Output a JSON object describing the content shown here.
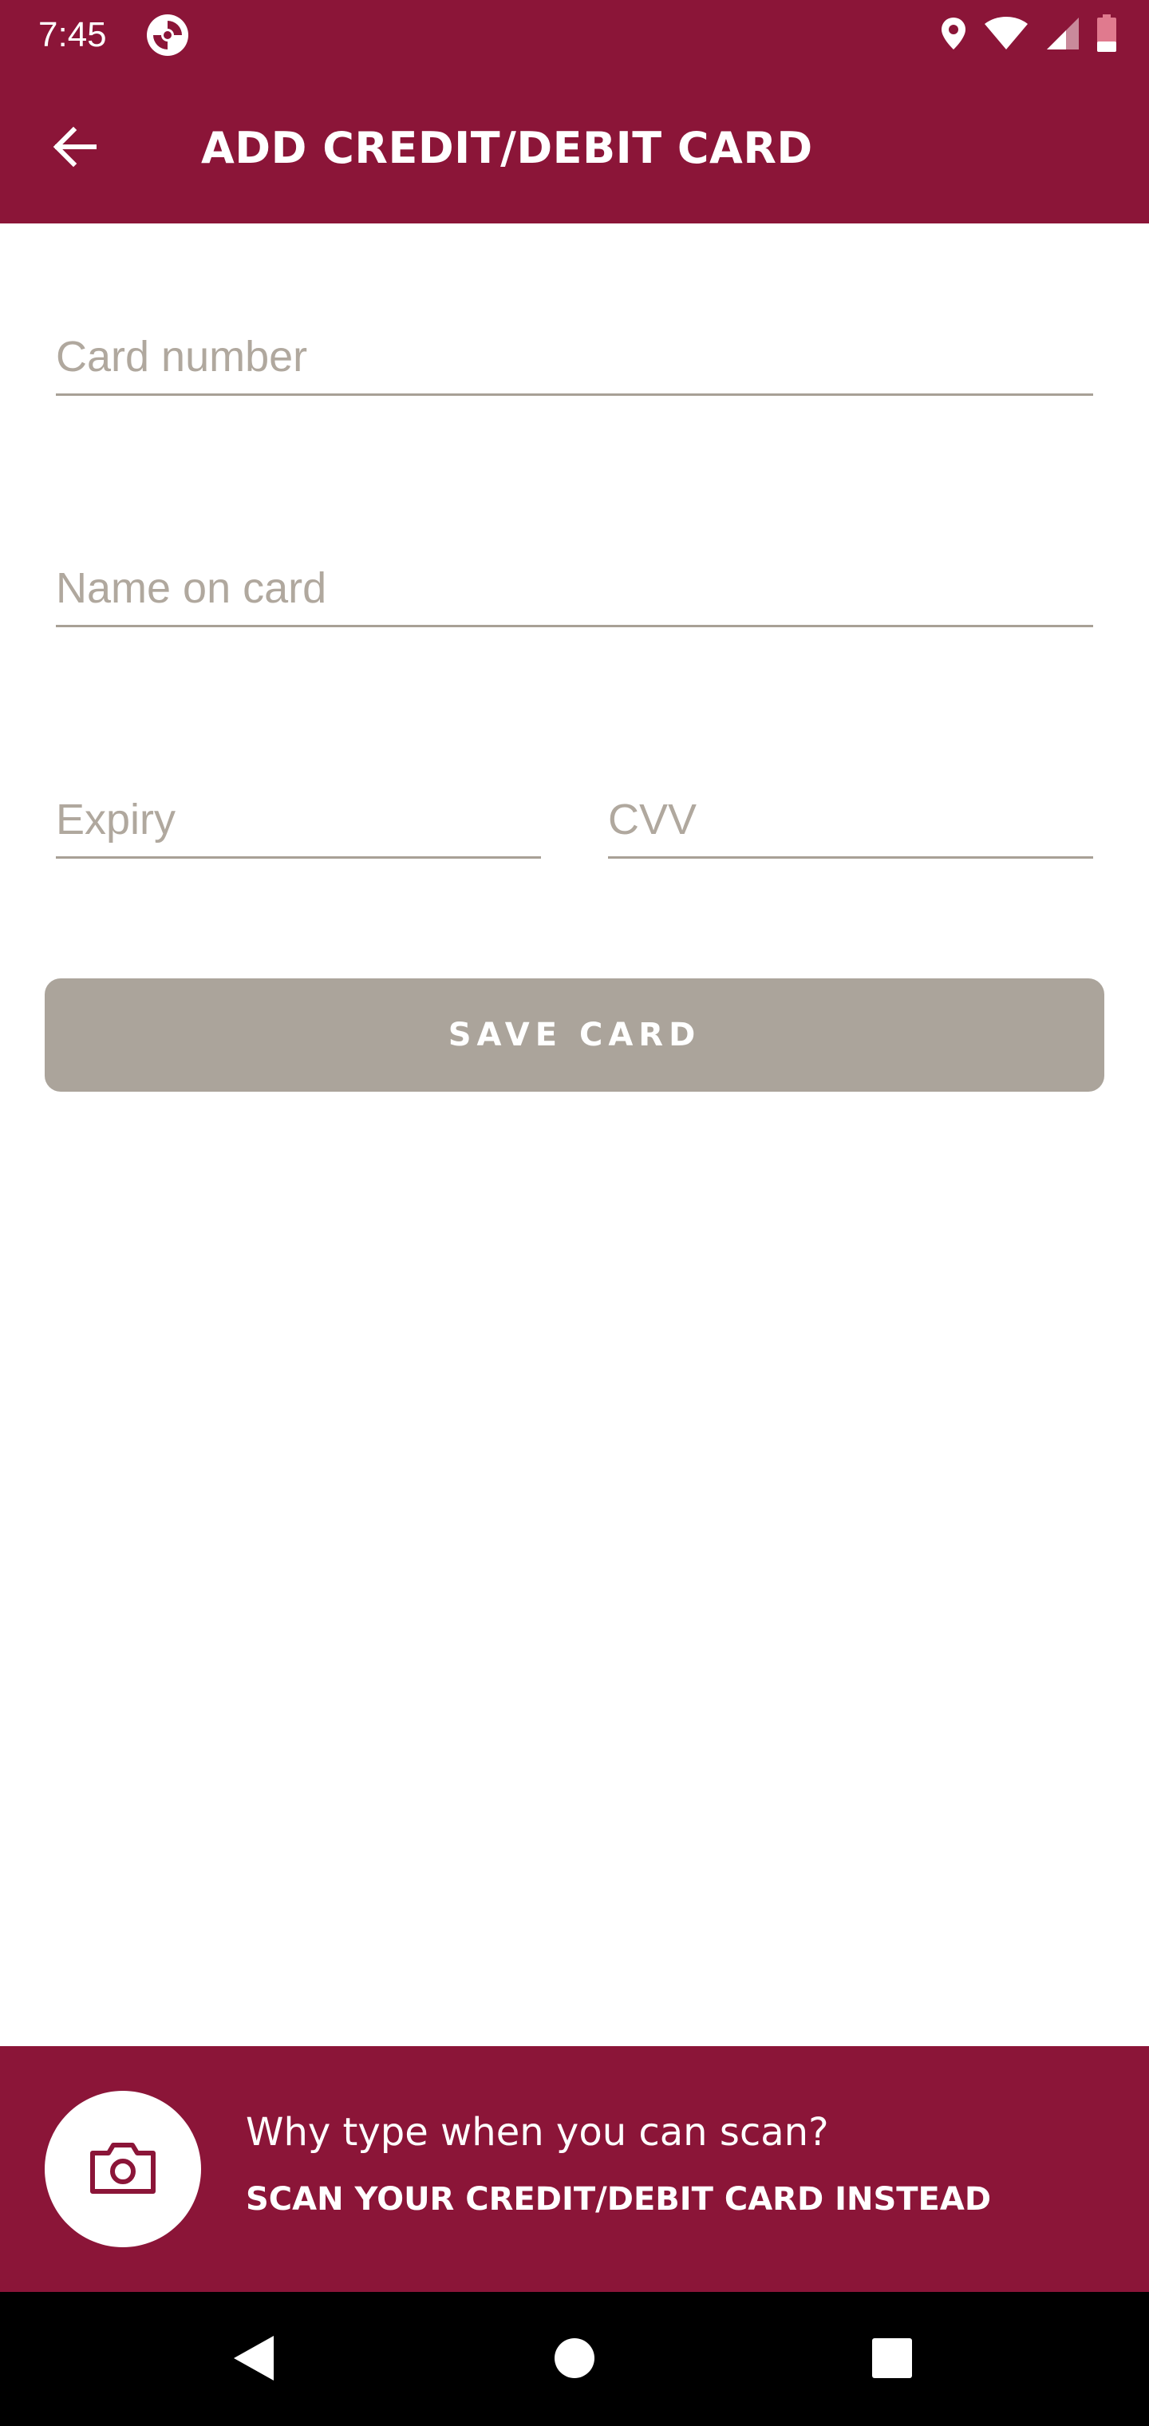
{
  "status_bar": {
    "time": "7:45",
    "icons": [
      "app-notification-icon",
      "location-icon",
      "wifi-icon",
      "cell-signal-icon",
      "battery-icon"
    ],
    "battery_color": "#e07a8e"
  },
  "app_bar": {
    "title": "ADD CREDIT/DEBIT CARD",
    "back_icon": "arrow-back-icon"
  },
  "form": {
    "card_number": {
      "placeholder": "Card number",
      "value": ""
    },
    "name_on_card": {
      "placeholder": "Name on card",
      "value": ""
    },
    "expiry": {
      "placeholder": "Expiry",
      "value": ""
    },
    "cvv": {
      "placeholder": "CVV",
      "value": ""
    },
    "save_label": "SAVE CARD"
  },
  "scan_banner": {
    "question": "Why type when you can scan?",
    "action": "SCAN YOUR CREDIT/DEBIT CARD INSTEAD",
    "icon": "camera-icon"
  },
  "nav_bar": {
    "buttons": [
      "nav-back-icon",
      "nav-home-icon",
      "nav-recents-icon"
    ]
  },
  "colors": {
    "brand": "#8b1538",
    "button_disabled": "#aba49b",
    "placeholder": "#b0a89e",
    "underline": "#a8a096"
  }
}
